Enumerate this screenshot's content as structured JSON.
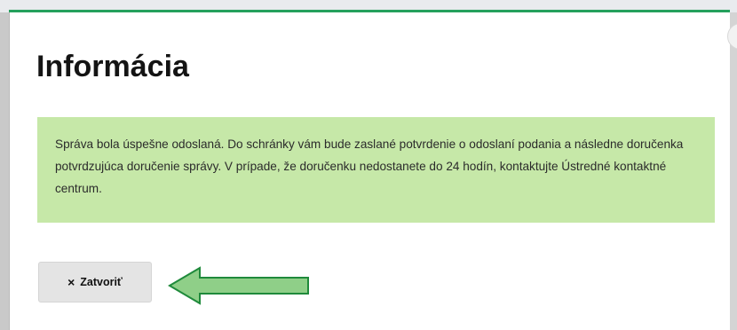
{
  "dialog": {
    "close_icon_glyph": "×",
    "title": "Informácia",
    "message": "Správa bola úspešne odoslaná. Do schránky vám bude zaslané potvrdenie o odoslaní podania a následne doručenka potvrdzujúca doručenie správy. V prípade, že doručenku nedostanete do 24 hodín, kontaktujte Ústredné kontaktné centrum.",
    "close_button_icon": "×",
    "close_button_label": "Zatvoriť"
  },
  "colors": {
    "accent_line": "#25a05d",
    "alert_bg": "#c6e8a8",
    "arrow_fill": "#8fcf88",
    "arrow_stroke": "#1f8a3b"
  },
  "icons": {
    "dialog_close": "close-icon",
    "button_close": "close-icon",
    "pointer_arrow": "arrow-left-icon"
  }
}
